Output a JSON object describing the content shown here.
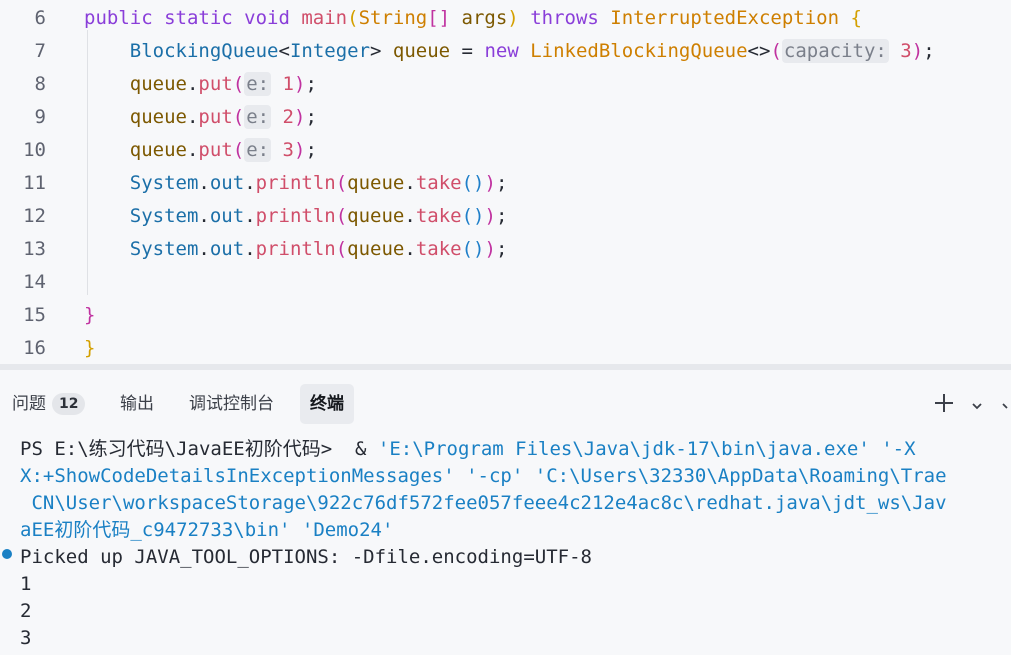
{
  "editor": {
    "lines": [
      {
        "num": "6",
        "parts": [
          [
            "kw",
            "public static void "
          ],
          [
            "fn",
            "main"
          ],
          [
            "br1",
            "("
          ],
          [
            "ty",
            "String"
          ],
          [
            "br2",
            "[] "
          ],
          [
            "var",
            "args"
          ],
          [
            "br1",
            ")"
          ],
          [
            "plain",
            " "
          ],
          [
            "kw",
            "throws "
          ],
          [
            "ty",
            "InterruptedException "
          ],
          [
            "br1",
            "{"
          ]
        ]
      },
      {
        "num": "7",
        "parts": [
          [
            "plain",
            "    "
          ],
          [
            "cls",
            "BlockingQueue"
          ],
          [
            "plain",
            "<"
          ],
          [
            "cls",
            "Integer"
          ],
          [
            "plain",
            "> "
          ],
          [
            "var",
            "queue"
          ],
          [
            "plain",
            " = "
          ],
          [
            "kw",
            "new "
          ],
          [
            "ty",
            "LinkedBlockingQueue"
          ],
          [
            "plain",
            "<>"
          ],
          [
            "br2",
            "("
          ],
          [
            "hint",
            "capacity:"
          ],
          [
            "num",
            " 3"
          ],
          [
            "br2",
            ")"
          ],
          [
            "plain",
            ";"
          ]
        ]
      },
      {
        "num": "8",
        "parts": [
          [
            "plain",
            "    "
          ],
          [
            "var",
            "queue"
          ],
          [
            "plain",
            "."
          ],
          [
            "fn",
            "put"
          ],
          [
            "br2",
            "("
          ],
          [
            "hint",
            "e:"
          ],
          [
            "num",
            " 1"
          ],
          [
            "br2",
            ")"
          ],
          [
            "plain",
            ";"
          ]
        ]
      },
      {
        "num": "9",
        "parts": [
          [
            "plain",
            "    "
          ],
          [
            "var",
            "queue"
          ],
          [
            "plain",
            "."
          ],
          [
            "fn",
            "put"
          ],
          [
            "br2",
            "("
          ],
          [
            "hint",
            "e:"
          ],
          [
            "num",
            " 2"
          ],
          [
            "br2",
            ")"
          ],
          [
            "plain",
            ";"
          ]
        ]
      },
      {
        "num": "10",
        "parts": [
          [
            "plain",
            "    "
          ],
          [
            "var",
            "queue"
          ],
          [
            "plain",
            "."
          ],
          [
            "fn",
            "put"
          ],
          [
            "br2",
            "("
          ],
          [
            "hint",
            "e:"
          ],
          [
            "num",
            " 3"
          ],
          [
            "br2",
            ")"
          ],
          [
            "plain",
            ";"
          ]
        ]
      },
      {
        "num": "11",
        "parts": [
          [
            "plain",
            "    "
          ],
          [
            "cls",
            "System"
          ],
          [
            "plain",
            "."
          ],
          [
            "cls",
            "out"
          ],
          [
            "plain",
            "."
          ],
          [
            "fn",
            "println"
          ],
          [
            "br2",
            "("
          ],
          [
            "var",
            "queue"
          ],
          [
            "plain",
            "."
          ],
          [
            "fn",
            "take"
          ],
          [
            "br3",
            "()"
          ],
          [
            "br2",
            ")"
          ],
          [
            "plain",
            ";"
          ]
        ]
      },
      {
        "num": "12",
        "parts": [
          [
            "plain",
            "    "
          ],
          [
            "cls",
            "System"
          ],
          [
            "plain",
            "."
          ],
          [
            "cls",
            "out"
          ],
          [
            "plain",
            "."
          ],
          [
            "fn",
            "println"
          ],
          [
            "br2",
            "("
          ],
          [
            "var",
            "queue"
          ],
          [
            "plain",
            "."
          ],
          [
            "fn",
            "take"
          ],
          [
            "br3",
            "()"
          ],
          [
            "br2",
            ")"
          ],
          [
            "plain",
            ";"
          ]
        ]
      },
      {
        "num": "13",
        "parts": [
          [
            "plain",
            "    "
          ],
          [
            "cls",
            "System"
          ],
          [
            "plain",
            "."
          ],
          [
            "cls",
            "out"
          ],
          [
            "plain",
            "."
          ],
          [
            "fn",
            "println"
          ],
          [
            "br2",
            "("
          ],
          [
            "var",
            "queue"
          ],
          [
            "plain",
            "."
          ],
          [
            "fn",
            "take"
          ],
          [
            "br3",
            "()"
          ],
          [
            "br2",
            ")"
          ],
          [
            "plain",
            ";"
          ]
        ]
      },
      {
        "num": "14",
        "parts": []
      },
      {
        "num": "15",
        "parts": [
          [
            "br2",
            "}"
          ]
        ]
      },
      {
        "num": "16",
        "parts": [
          [
            "br1",
            "}"
          ]
        ]
      }
    ]
  },
  "panel": {
    "tabs": [
      {
        "label": "问题",
        "badge": "12"
      },
      {
        "label": "输出"
      },
      {
        "label": "调试控制台"
      },
      {
        "label": "终端",
        "active": true
      }
    ],
    "icons": [
      "plus-icon",
      "chevron-down-icon"
    ]
  },
  "terminal": {
    "lines": [
      {
        "parts": [
          [
            "plain",
            "PS E:\\练习代码\\JavaEE初阶代码>  & "
          ],
          [
            "tstr",
            "'E:\\Program Files\\Java\\jdk-17\\bin\\java.exe' '-X"
          ]
        ]
      },
      {
        "parts": [
          [
            "tstr",
            "X:+ShowCodeDetailsInExceptionMessages' '-cp' 'C:\\Users\\32330\\AppData\\Roaming\\Trae"
          ]
        ]
      },
      {
        "parts": [
          [
            "tstr",
            " CN\\User\\workspaceStorage\\922c76df572fee057feee4c212e4ac8c\\redhat.java\\jdt_ws\\Jav"
          ]
        ]
      },
      {
        "parts": [
          [
            "tstr",
            "aEE初阶代码_c9472733\\bin' 'Demo24'"
          ]
        ]
      },
      {
        "parts": [
          [
            "plain",
            "Picked up JAVA_TOOL_OPTIONS: -Dfile.encoding=UTF-8"
          ]
        ]
      },
      {
        "parts": [
          [
            "plain",
            "1"
          ]
        ]
      },
      {
        "parts": [
          [
            "plain",
            "2"
          ]
        ]
      },
      {
        "parts": [
          [
            "plain",
            "3"
          ]
        ]
      }
    ]
  }
}
